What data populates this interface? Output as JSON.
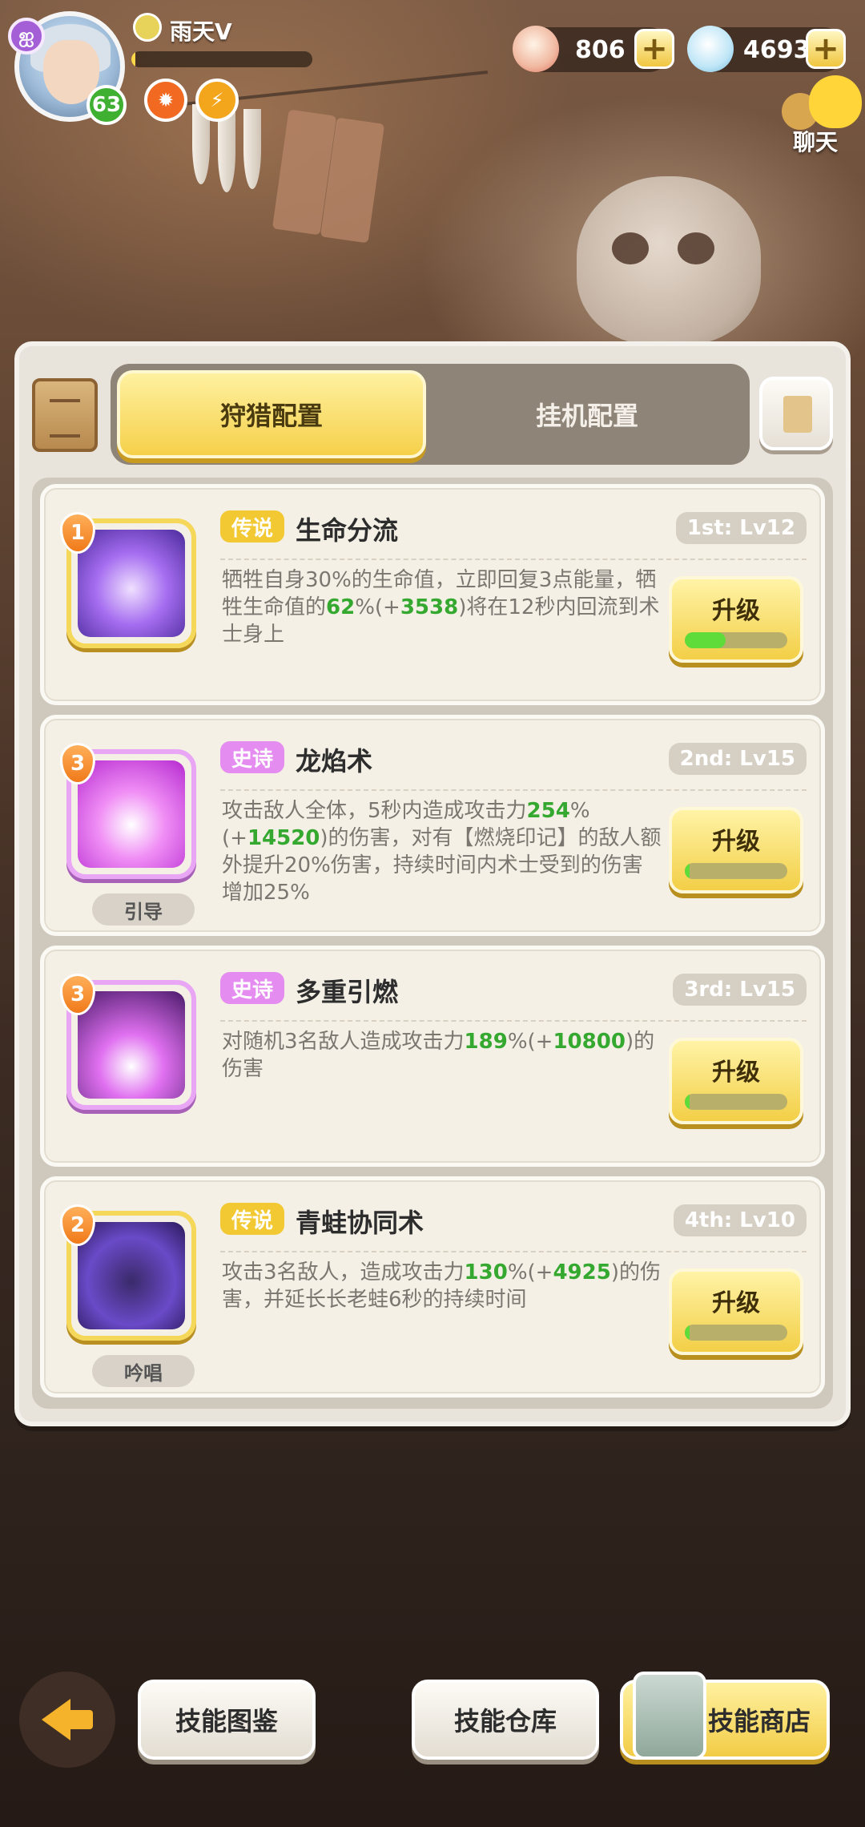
{
  "player": {
    "name": "雨天V",
    "level": "63",
    "xp_progress": 0.02
  },
  "currencies": [
    {
      "name": "shell-currency",
      "value": "806",
      "icon": "shell-icon"
    },
    {
      "name": "diamond-currency",
      "value": "4693",
      "icon": "crystal-icon"
    }
  ],
  "chat": {
    "label": "聊天"
  },
  "tabs": {
    "hunt": "狩猎配置",
    "idle": "挂机配置",
    "active": "hunt"
  },
  "skills": [
    {
      "rarity": "传说",
      "rarity_key": "legend",
      "name": "生命分流",
      "slot": "1st: Lv12",
      "star": "1",
      "desc_parts": [
        "牺牲自身30%的生命值，立即回复3点能量，牺牲生命值的",
        "62",
        "%(+",
        "3538",
        ")将在12秒内回流到术士身上"
      ],
      "upgrade_label": "升级",
      "progress": 0.4,
      "type": ""
    },
    {
      "rarity": "史诗",
      "rarity_key": "epic",
      "name": "龙焰术",
      "slot": "2nd: Lv15",
      "star": "3",
      "desc_parts": [
        "攻击敌人全体，5秒内造成攻击力",
        "254",
        "%(+",
        "14520",
        ")的伤害，对有【燃烧印记】的敌人额外提升20%伤害，持续时间内术士受到的伤害增加25%"
      ],
      "upgrade_label": "升级",
      "progress": 0.05,
      "type": "引导"
    },
    {
      "rarity": "史诗",
      "rarity_key": "epic",
      "name": "多重引燃",
      "slot": "3rd: Lv15",
      "star": "3",
      "desc_parts": [
        "对随机3名敌人造成攻击力",
        "189",
        "%(+",
        "10800",
        ")的伤害"
      ],
      "upgrade_label": "升级",
      "progress": 0.05,
      "type": ""
    },
    {
      "rarity": "传说",
      "rarity_key": "legend",
      "name": "青蛙协同术",
      "slot": "4th: Lv10",
      "star": "2",
      "desc_parts": [
        "攻击3名敌人，造成攻击力",
        "130",
        "%(+",
        "4925",
        ")的伤害，并延长长老蛙6秒的持续时间"
      ],
      "upgrade_label": "升级",
      "progress": 0.05,
      "type": "吟唱"
    }
  ],
  "bottom": {
    "codex": "技能图鉴",
    "storage": "技能仓库",
    "shop": "技能商店"
  },
  "colors": {
    "accent_yellow": "#f2c933",
    "epic_pink": "#e48cf0",
    "highlight_green": "#34a82f"
  }
}
